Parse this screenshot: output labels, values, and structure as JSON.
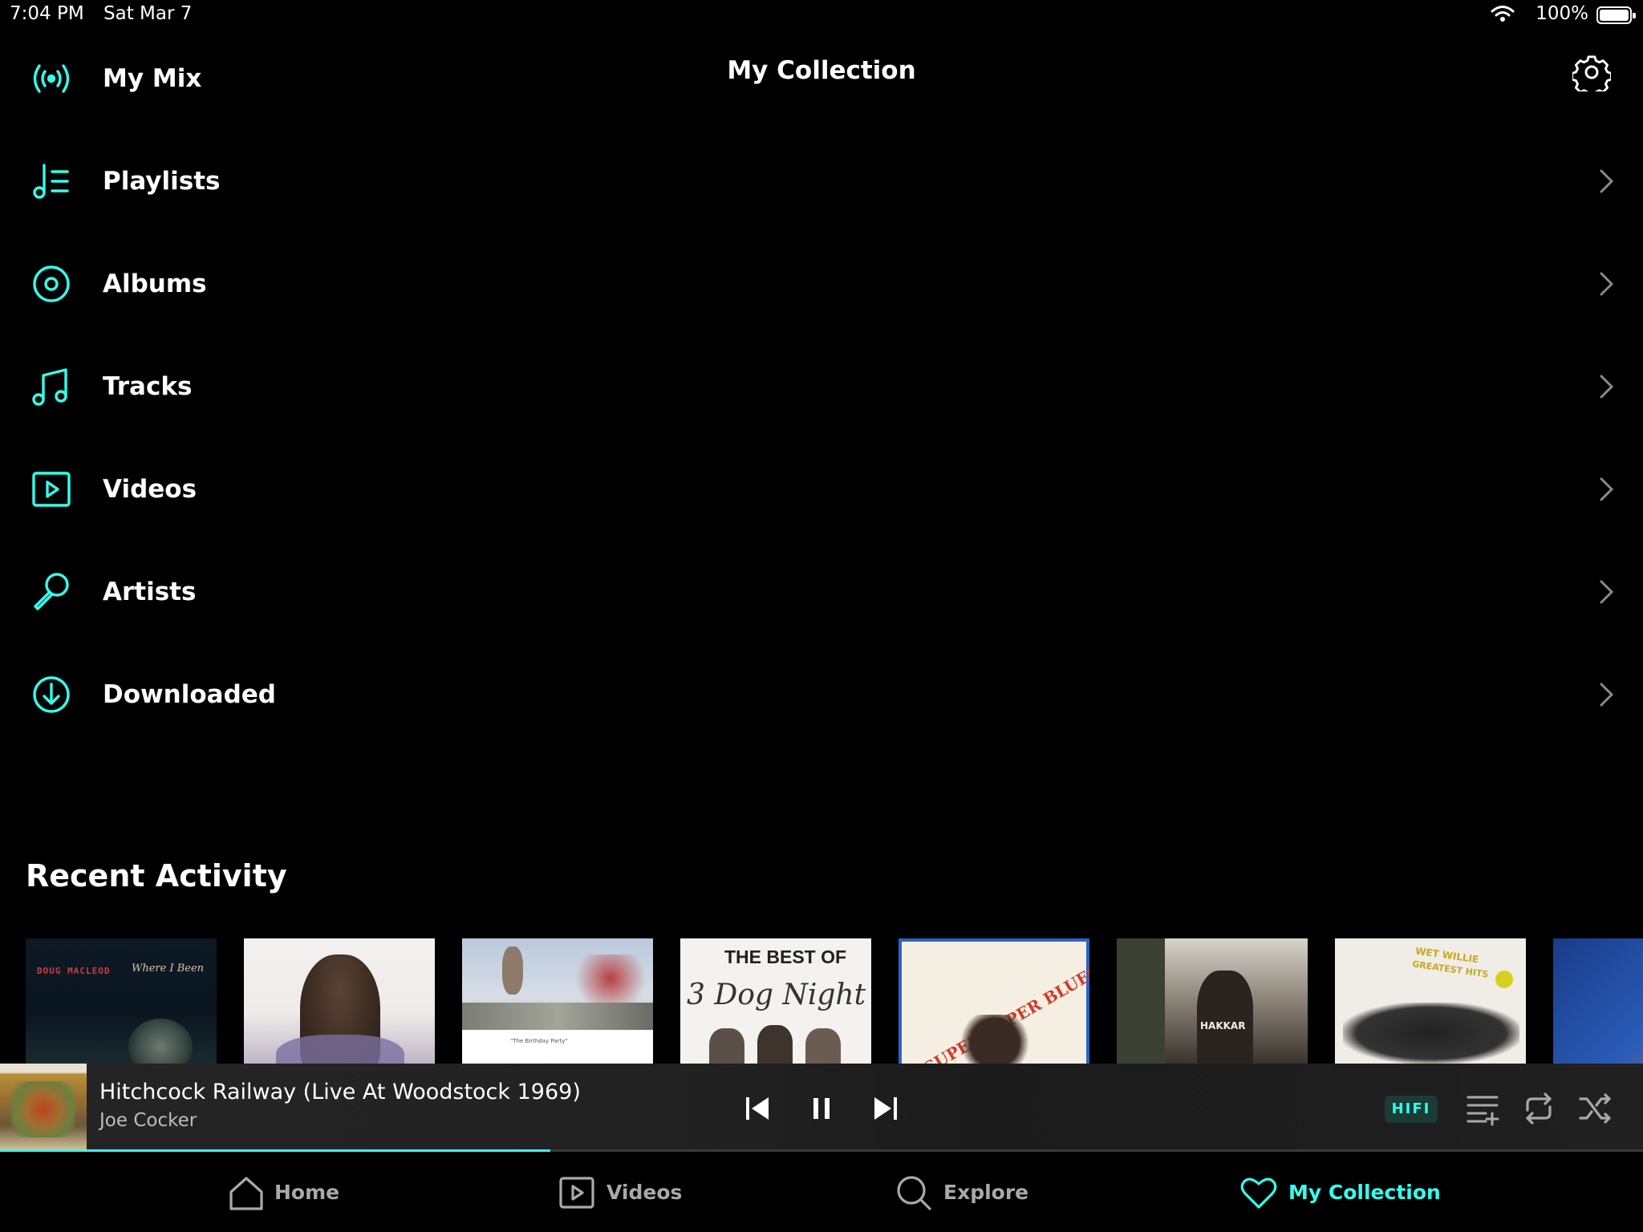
{
  "status_bar": {
    "time": "7:04 PM",
    "date": "Sat Mar 7",
    "battery": "100%"
  },
  "header": {
    "title": "My Collection"
  },
  "menu": [
    {
      "label": "My Mix",
      "icon": "radio-waves-icon"
    },
    {
      "label": "Playlists",
      "icon": "playlist-icon"
    },
    {
      "label": "Albums",
      "icon": "album-disc-icon"
    },
    {
      "label": "Tracks",
      "icon": "music-note-icon"
    },
    {
      "label": "Videos",
      "icon": "video-play-icon"
    },
    {
      "label": "Artists",
      "icon": "microphone-icon"
    },
    {
      "label": "Downloaded",
      "icon": "download-circle-icon"
    }
  ],
  "recent": {
    "title": "Recent Activity",
    "items": [
      {
        "name": "recent-album-1",
        "text": "DOUG MACLEOD",
        "text2": "Where I Been"
      },
      {
        "name": "recent-album-2",
        "text": "",
        "text2": ""
      },
      {
        "name": "recent-album-3",
        "text": "\"The Birthday Party\"",
        "text2": ""
      },
      {
        "name": "recent-album-4",
        "text": "THE BEST OF",
        "text2": "3 Dog Night"
      },
      {
        "name": "recent-album-5",
        "text": "SUPER SUPER BLUES BAND",
        "text2": ""
      },
      {
        "name": "recent-album-6",
        "text": "HAKKAR",
        "text2": ""
      },
      {
        "name": "recent-album-7",
        "text": "WET WILLIE",
        "text2": "GREATEST HITS"
      },
      {
        "name": "recent-album-8",
        "text": "",
        "text2": ""
      }
    ]
  },
  "player": {
    "track": "Hitchcock Railway (Live At Woodstock 1969)",
    "artist": "Joe Cocker",
    "quality": "HIFI",
    "progress": 0.335
  },
  "tabs": [
    {
      "label": "Home",
      "icon": "home-icon"
    },
    {
      "label": "Videos",
      "icon": "video-icon"
    },
    {
      "label": "Explore",
      "icon": "search-icon"
    },
    {
      "label": "My Collection",
      "icon": "heart-icon"
    }
  ],
  "colors": {
    "accent": "#33ffee",
    "background": "#000000",
    "muted": "#a9a9a9"
  }
}
